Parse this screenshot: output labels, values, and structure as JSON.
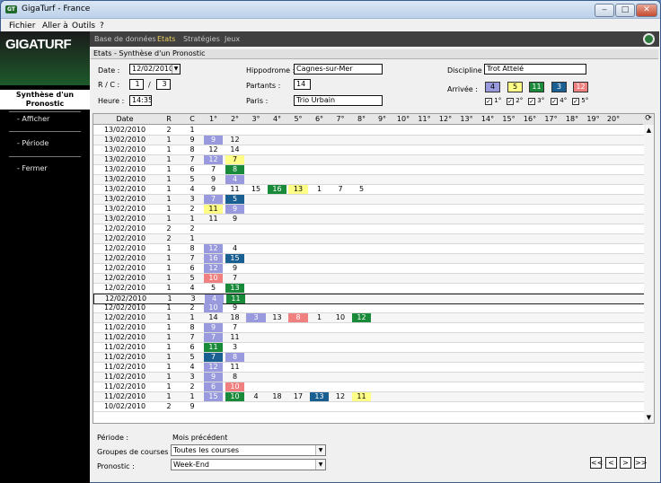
{
  "window": {
    "title": "GigaTurf - France"
  },
  "menu": [
    "Fichier",
    "Aller à",
    "Outils",
    "?"
  ],
  "toolbar": {
    "logo": "GIGATURF",
    "items": [
      "Base de données",
      "Etats",
      "Stratégies",
      "Jeux"
    ],
    "active": "Etats"
  },
  "sidebar": {
    "active": "Synthèse d'un Pronostic",
    "items": [
      "- Afficher",
      "- Période",
      "- Fermer"
    ]
  },
  "breadcrumb": "Etats - Synthèse d'un Pronostic",
  "form": {
    "date_label": "Date :",
    "date": "12/02/2010",
    "rc_label": "R / C :",
    "r": "1",
    "c": "3",
    "heure_label": "Heure :",
    "heure": "14:35",
    "hippodrome_label": "Hippodrome :",
    "hippodrome": "Cagnes-sur-Mer",
    "partants_label": "Partants :",
    "partants": "14",
    "paris_label": "Paris :",
    "paris": "Trio Urbain",
    "discipline_label": "Discipline :",
    "discipline": "Trot Attelé",
    "arrivee_label": "Arrivée :",
    "arrivee": [
      "4",
      "5",
      "11",
      "3",
      "12"
    ],
    "arrivee_checks": [
      "1°",
      "2°",
      "3°",
      "4°",
      "5°"
    ]
  },
  "colors": {
    "purple": "#9999dd",
    "yellow": "#ffff88",
    "green": "#188a3a",
    "blue": "#1a5f92",
    "red": "#f07f7f"
  },
  "table": {
    "columns": [
      "Date",
      "R",
      "C",
      "1°",
      "2°",
      "3°",
      "4°",
      "5°",
      "6°",
      "7°",
      "8°",
      "9°",
      "10°",
      "11°",
      "12°",
      "13°",
      "14°",
      "15°",
      "16°",
      "17°",
      "18°",
      "19°",
      "20°"
    ],
    "rows": [
      {
        "date": "13/02/2010",
        "r": "2",
        "c": "1",
        "cells": []
      },
      {
        "date": "13/02/2010",
        "r": "1",
        "c": "9",
        "cells": [
          [
            "9",
            "p"
          ],
          [
            "12",
            ""
          ]
        ]
      },
      {
        "date": "13/02/2010",
        "r": "1",
        "c": "8",
        "cells": [
          [
            "12",
            ""
          ],
          [
            "14",
            ""
          ]
        ]
      },
      {
        "date": "13/02/2010",
        "r": "1",
        "c": "7",
        "cells": [
          [
            "12",
            "p"
          ],
          [
            "7",
            "y"
          ]
        ]
      },
      {
        "date": "13/02/2010",
        "r": "1",
        "c": "6",
        "cells": [
          [
            "7",
            ""
          ],
          [
            "8",
            "g"
          ]
        ]
      },
      {
        "date": "13/02/2010",
        "r": "1",
        "c": "5",
        "cells": [
          [
            "9",
            ""
          ],
          [
            "4",
            "p"
          ]
        ]
      },
      {
        "date": "13/02/2010",
        "r": "1",
        "c": "4",
        "cells": [
          [
            "9",
            ""
          ],
          [
            "11",
            ""
          ],
          [
            "15",
            ""
          ],
          [
            "16",
            "g"
          ],
          [
            "13",
            "y"
          ],
          [
            "1",
            ""
          ],
          [
            "7",
            ""
          ],
          [
            "5",
            ""
          ]
        ]
      },
      {
        "date": "13/02/2010",
        "r": "1",
        "c": "3",
        "cells": [
          [
            "7",
            "p"
          ],
          [
            "5",
            "b"
          ]
        ]
      },
      {
        "date": "13/02/2010",
        "r": "1",
        "c": "2",
        "cells": [
          [
            "11",
            "y"
          ],
          [
            "9",
            "p"
          ]
        ]
      },
      {
        "date": "13/02/2010",
        "r": "1",
        "c": "1",
        "cells": [
          [
            "11",
            ""
          ],
          [
            "9",
            ""
          ]
        ]
      },
      {
        "date": "12/02/2010",
        "r": "2",
        "c": "2",
        "cells": []
      },
      {
        "date": "12/02/2010",
        "r": "2",
        "c": "1",
        "cells": []
      },
      {
        "date": "12/02/2010",
        "r": "1",
        "c": "8",
        "cells": [
          [
            "12",
            "p"
          ],
          [
            "4",
            ""
          ]
        ]
      },
      {
        "date": "12/02/2010",
        "r": "1",
        "c": "7",
        "cells": [
          [
            "16",
            "p"
          ],
          [
            "15",
            "b"
          ]
        ]
      },
      {
        "date": "12/02/2010",
        "r": "1",
        "c": "6",
        "cells": [
          [
            "12",
            "p"
          ],
          [
            "9",
            ""
          ]
        ]
      },
      {
        "date": "12/02/2010",
        "r": "1",
        "c": "5",
        "cells": [
          [
            "10",
            "r"
          ],
          [
            "7",
            ""
          ]
        ]
      },
      {
        "date": "12/02/2010",
        "r": "1",
        "c": "4",
        "cells": [
          [
            "5",
            ""
          ],
          [
            "13",
            "g"
          ]
        ]
      },
      {
        "date": "12/02/2010",
        "r": "1",
        "c": "3",
        "cells": [
          [
            "4",
            "p"
          ],
          [
            "11",
            "g"
          ]
        ],
        "selected": true
      },
      {
        "date": "12/02/2010",
        "r": "1",
        "c": "2",
        "cells": [
          [
            "10",
            "p"
          ],
          [
            "9",
            ""
          ]
        ]
      },
      {
        "date": "12/02/2010",
        "r": "1",
        "c": "1",
        "cells": [
          [
            "14",
            ""
          ],
          [
            "18",
            ""
          ],
          [
            "3",
            "p"
          ],
          [
            "13",
            ""
          ],
          [
            "8",
            "r"
          ],
          [
            "1",
            ""
          ],
          [
            "10",
            ""
          ],
          [
            "12",
            "g"
          ]
        ]
      },
      {
        "date": "11/02/2010",
        "r": "1",
        "c": "8",
        "cells": [
          [
            "9",
            "p"
          ],
          [
            "7",
            ""
          ]
        ]
      },
      {
        "date": "11/02/2010",
        "r": "1",
        "c": "7",
        "cells": [
          [
            "7",
            "p"
          ],
          [
            "11",
            ""
          ]
        ]
      },
      {
        "date": "11/02/2010",
        "r": "1",
        "c": "6",
        "cells": [
          [
            "11",
            "g"
          ],
          [
            "3",
            ""
          ]
        ]
      },
      {
        "date": "11/02/2010",
        "r": "1",
        "c": "5",
        "cells": [
          [
            "7",
            "b"
          ],
          [
            "8",
            "p"
          ]
        ]
      },
      {
        "date": "11/02/2010",
        "r": "1",
        "c": "4",
        "cells": [
          [
            "12",
            "p"
          ],
          [
            "11",
            ""
          ]
        ]
      },
      {
        "date": "11/02/2010",
        "r": "1",
        "c": "3",
        "cells": [
          [
            "9",
            "p"
          ],
          [
            "8",
            ""
          ]
        ]
      },
      {
        "date": "11/02/2010",
        "r": "1",
        "c": "2",
        "cells": [
          [
            "6",
            "p"
          ],
          [
            "10",
            "r"
          ]
        ]
      },
      {
        "date": "11/02/2010",
        "r": "1",
        "c": "1",
        "cells": [
          [
            "15",
            "p"
          ],
          [
            "10",
            "g"
          ],
          [
            "4",
            ""
          ],
          [
            "18",
            ""
          ],
          [
            "17",
            ""
          ],
          [
            "13",
            "b"
          ],
          [
            "12",
            ""
          ],
          [
            "11",
            "y"
          ]
        ]
      },
      {
        "date": "10/02/2010",
        "r": "2",
        "c": "9",
        "cells": []
      }
    ]
  },
  "footer": {
    "periode_label": "Période :",
    "periode": "Mois précédent",
    "groupes_label": "Groupes de courses :",
    "groupes": "Toutes les courses",
    "pronostic_label": "Pronostic :",
    "pronostic": "Week-End",
    "nav": [
      "<<",
      "<",
      ">",
      ">>"
    ]
  }
}
